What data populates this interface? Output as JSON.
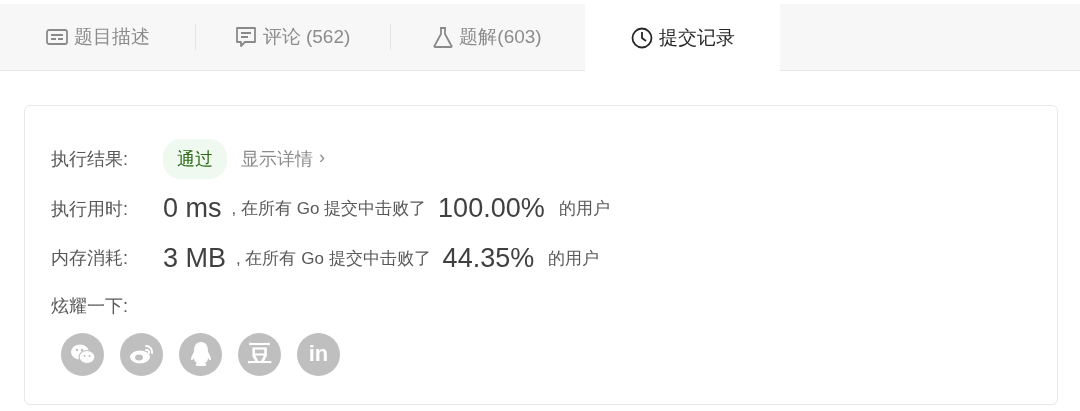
{
  "tabs": [
    {
      "label": "题目描述",
      "kind": "description",
      "selected": false
    },
    {
      "label": "评论 (562)",
      "kind": "comment",
      "selected": false
    },
    {
      "label": "题解(603)",
      "kind": "flask",
      "selected": false
    },
    {
      "label": "提交记录",
      "kind": "clock",
      "selected": true
    }
  ],
  "result": {
    "label": "执行结果:",
    "status": "通过",
    "details_link": "显示详情",
    "chevron": "›"
  },
  "stats": [
    {
      "label": "执行用时:",
      "value": "0 ms",
      "middle": ", 在所有 Go 提交中击败了",
      "percent": "100.00%",
      "suffix": "的用户"
    },
    {
      "label": "内存消耗:",
      "value": "3 MB",
      "middle": ", 在所有 Go 提交中击败了",
      "percent": "44.35%",
      "suffix": "的用户"
    }
  ],
  "share": {
    "label": "炫耀一下:",
    "buttons": [
      {
        "kind": "wechat"
      },
      {
        "kind": "weibo"
      },
      {
        "kind": "qq"
      },
      {
        "kind": "douban",
        "glyph": "豆"
      },
      {
        "kind": "linkedin",
        "glyph": "in"
      }
    ]
  }
}
